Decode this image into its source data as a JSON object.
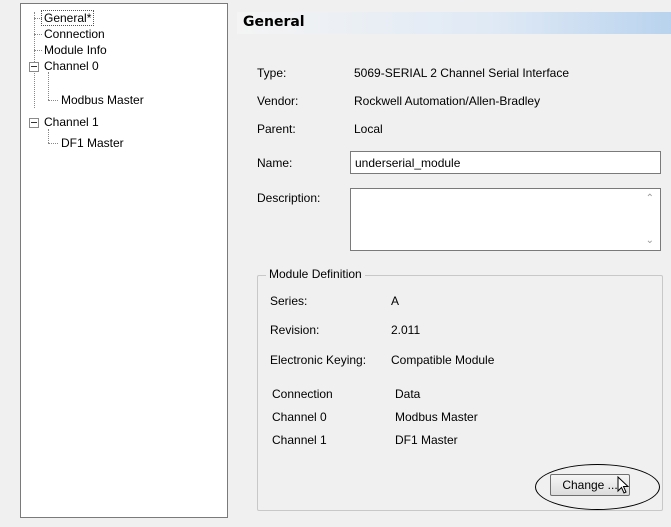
{
  "tree": {
    "items": [
      {
        "label": "General*"
      },
      {
        "label": "Connection"
      },
      {
        "label": "Module Info"
      },
      {
        "label": "Channel 0"
      },
      {
        "label": "Modbus Master"
      },
      {
        "label": "Channel 1"
      },
      {
        "label": "DF1 Master"
      }
    ]
  },
  "header": {
    "title": "General"
  },
  "fields": {
    "type_label": "Type:",
    "type_value": "5069-SERIAL 2 Channel Serial Interface",
    "vendor_label": "Vendor:",
    "vendor_value": "Rockwell Automation/Allen-Bradley",
    "parent_label": "Parent:",
    "parent_value": "Local",
    "name_label": "Name:",
    "name_value": "underserial_module",
    "description_label": "Description:",
    "description_value": ""
  },
  "module_definition": {
    "legend": "Module Definition",
    "series_label": "Series:",
    "series_value": "A",
    "revision_label": "Revision:",
    "revision_value": "2.011",
    "keying_label": "Electronic Keying:",
    "keying_value": "Compatible Module",
    "rows": [
      {
        "name": "Connection",
        "value": "Data"
      },
      {
        "name": "Channel 0",
        "value": "Modbus Master"
      },
      {
        "name": "Channel 1",
        "value": "DF1 Master"
      }
    ],
    "change_button": "Change ..."
  }
}
